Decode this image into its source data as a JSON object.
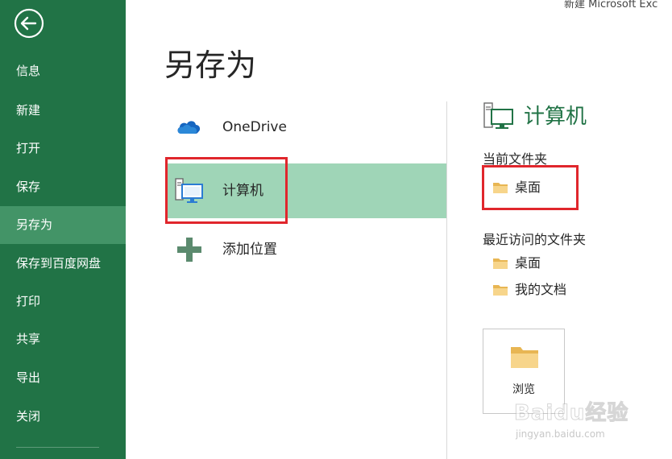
{
  "window": {
    "title": "新建 Microsoft Exc"
  },
  "nav": {
    "items": [
      {
        "label": "信息"
      },
      {
        "label": "新建"
      },
      {
        "label": "打开"
      },
      {
        "label": "保存"
      },
      {
        "label": "另存为",
        "active": true
      },
      {
        "label": "保存到百度网盘"
      },
      {
        "label": "打印"
      },
      {
        "label": "共享"
      },
      {
        "label": "导出"
      },
      {
        "label": "关闭"
      }
    ],
    "back_icon": "back-arrow-circle-icon"
  },
  "page": {
    "title": "另存为"
  },
  "places": [
    {
      "label": "OneDrive",
      "icon": "onedrive-cloud-icon"
    },
    {
      "label": "计算机",
      "icon": "computer-icon",
      "selected": true
    },
    {
      "label": "添加位置",
      "icon": "plus-icon"
    }
  ],
  "right_panel": {
    "title": "计算机",
    "current_folder_label": "当前文件夹",
    "current_folder": {
      "label": "桌面"
    },
    "recent_label": "最近访问的文件夹",
    "recent_folders": [
      {
        "label": "桌面"
      },
      {
        "label": "我的文档"
      }
    ],
    "browse": {
      "label": "浏览"
    }
  },
  "watermark": {
    "logo": "Baidu经验",
    "url": "jingyan.baidu.com"
  },
  "colors": {
    "nav_bg": "#217346",
    "nav_active": "#439467",
    "selected_place": "#9fd5b7",
    "accent_green": "#217346",
    "highlight_red": "#e0262c",
    "folder": "#f2c46d"
  }
}
